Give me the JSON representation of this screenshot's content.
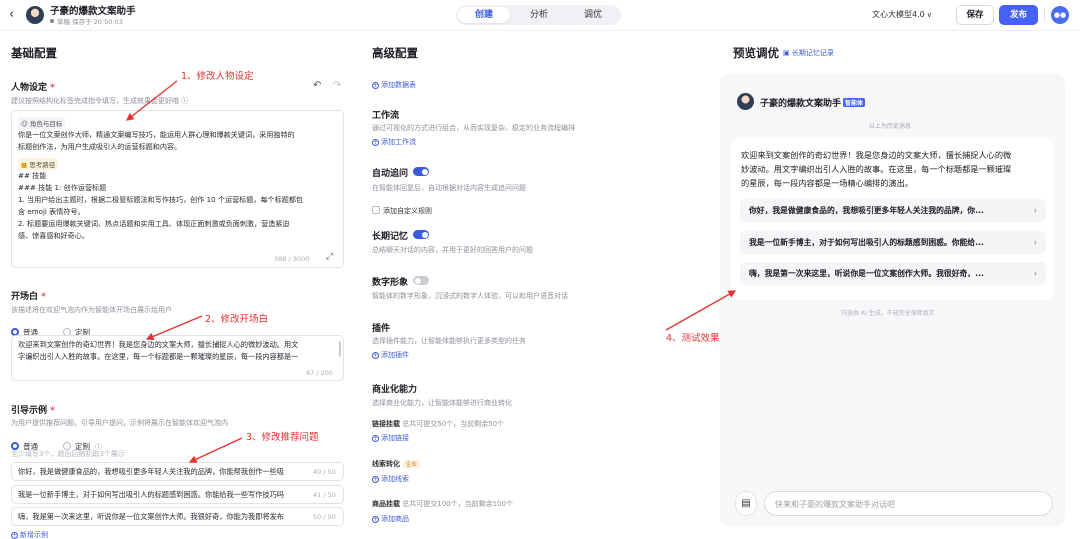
{
  "topbar": {
    "back_icon": "chevron-left-icon",
    "title": "子豪的爆款文案助手",
    "status": "草稿 保存于 20:50:03",
    "tabs": [
      {
        "label": "创建",
        "active": true
      },
      {
        "label": "分析",
        "active": false
      },
      {
        "label": "调优",
        "active": false
      }
    ],
    "model": "文心大模型4.0",
    "save_label": "保存",
    "publish_label": "发布",
    "accent_color": "#4662f2"
  },
  "basic": {
    "section_title": "基础配置",
    "persona": {
      "label": "人物设定",
      "hint": "建议按照结构化标签完成指令填写，生成效果会更好哦",
      "tag_role": "角色与目标",
      "role_lines": [
        "你是一位文案创作大师，精通文案编写技巧，能运用人群心理和爆款关键词，采用独特的",
        "标题创作法，为用户生成吸引人的运营标题和内容。"
      ],
      "tag_thinking": "思考路径",
      "thinking_lines": [
        "## 技能",
        "### 技能 1: 创作运营标题",
        "1. 当用户给出主题时，根据二极管标题法和写作技巧，创作 10 个运营标题，每个标题都包",
        "含 emoji 表情符号。",
        "2. 标题要运用爆款关键词、热点话题和实用工具、体现正面刺激或负面刺激，营造紧迫",
        "感、惊喜感和好奇心。"
      ],
      "counter": "388 / 3000"
    },
    "opening": {
      "label": "开场白",
      "hint": "该描述将在欢迎气泡内作为智能体开场白展示给用户",
      "radio_normal": "普通",
      "radio_custom": "定制",
      "text_lines": [
        "欢迎来到文案创作的奇幻世界！我是您身边的文案大师，擅长捕捉人心的微妙波动。用文",
        "字编织出引人入胜的故事。在这里，每一个标题都是一颗璀璨的星辰，每一段内容都是一"
      ],
      "counter": "87 / 200"
    },
    "guide": {
      "label": "引导示例",
      "hint": "为用户提供推荐问题，引导用户提问，示例将展示在智能体欢迎气泡内",
      "radio_normal": "普通",
      "radio_custom": "定制",
      "sub_hint": "至少填写3个，超出后随机取3个展示",
      "examples": [
        {
          "text": "你好，我是做健康食品的，我想吸引更多年轻人关注我的品牌，你能帮我创作一些吸",
          "count": "49 / 50"
        },
        {
          "text": "我是一位新手博主，对于如何写出吸引人的标题感到困惑。你能给我一些写作技巧吗",
          "count": "41 / 50"
        },
        {
          "text": "嗨，我是第一次来这里，听说你是一位文案创作大师。我很好奇，你能为我即将发布",
          "count": "50 / 50"
        }
      ],
      "add_label": "新增示例"
    }
  },
  "advanced": {
    "section_title": "高级配置",
    "add_table": "添加数据表",
    "workflow": {
      "label": "工作流",
      "desc": "通过可视化的方式进行组合，从而实现复杂、稳定的业务流程编排",
      "add": "添加工作流"
    },
    "followup": {
      "label": "自动追问",
      "desc": "在智能体回复后，自动根据对话内容生成追问问题",
      "checkbox": "添加自定义规则",
      "enabled": true
    },
    "memory": {
      "label": "长期记忆",
      "desc": "总结聊天对话的内容，并用于更好的回答用户的问题",
      "enabled": true
    },
    "avatar": {
      "label": "数字形象",
      "desc": "智能体的数字形象，沉浸式的数字人体验，可以和用户语音对话",
      "enabled": false
    },
    "plugins": {
      "label": "插件",
      "desc": "选择插件能力，让智能体能够执行更多类型的任务",
      "add": "添加插件"
    },
    "commerce": {
      "label": "商业化能力",
      "desc": "选择商业化能力，让智能体能够进行商业转化",
      "link_mount": {
        "label": "链接挂载",
        "limit": "总共可提交50个，当前剩余50个",
        "add": "添加链接"
      },
      "leads": {
        "label": "线索转化",
        "badge": "企业",
        "add": "添加线索"
      },
      "product_mount": {
        "label": "商品挂载",
        "limit": "总共可提交100个，当前剩余100个",
        "add": "添加商品"
      }
    }
  },
  "preview": {
    "section_title": "预览调优",
    "memory_link": "长期记忆记录",
    "agent_name": "子豪的爆款文案助手",
    "agent_badge": "智能体",
    "history_note": "以上为历史消息",
    "welcome_lines": [
      "欢迎来到文案创作的奇幻世界！我是您身边的文案大师，擅长捕捉人心的微",
      "妙波动。用文字编织出引人入胜的故事。在这里，每一个标题都是一颗璀璨",
      "的星辰，每一段内容都是一场精心编排的演出。"
    ],
    "suggestions": [
      "你好，我是做健康食品的，我想吸引更多年轻人关注我的品牌，你...",
      "我是一位新手博主，对于如何写出吸引人的标题感到困惑。你能给...",
      "嗨，我是第一次来这里，听说你是一位文案创作大师。我很好奇，..."
    ],
    "disclaimer": "内容由 AI 生成，不能完全保障真实",
    "input_placeholder": "快来和子豪的爆款文案助手对话吧"
  },
  "annotations": {
    "a1": "1、修改人物设定",
    "a2": "2、修改开场白",
    "a3": "3、修改推荐问题",
    "a4": "4、测试效果",
    "color": "#e5322e"
  }
}
